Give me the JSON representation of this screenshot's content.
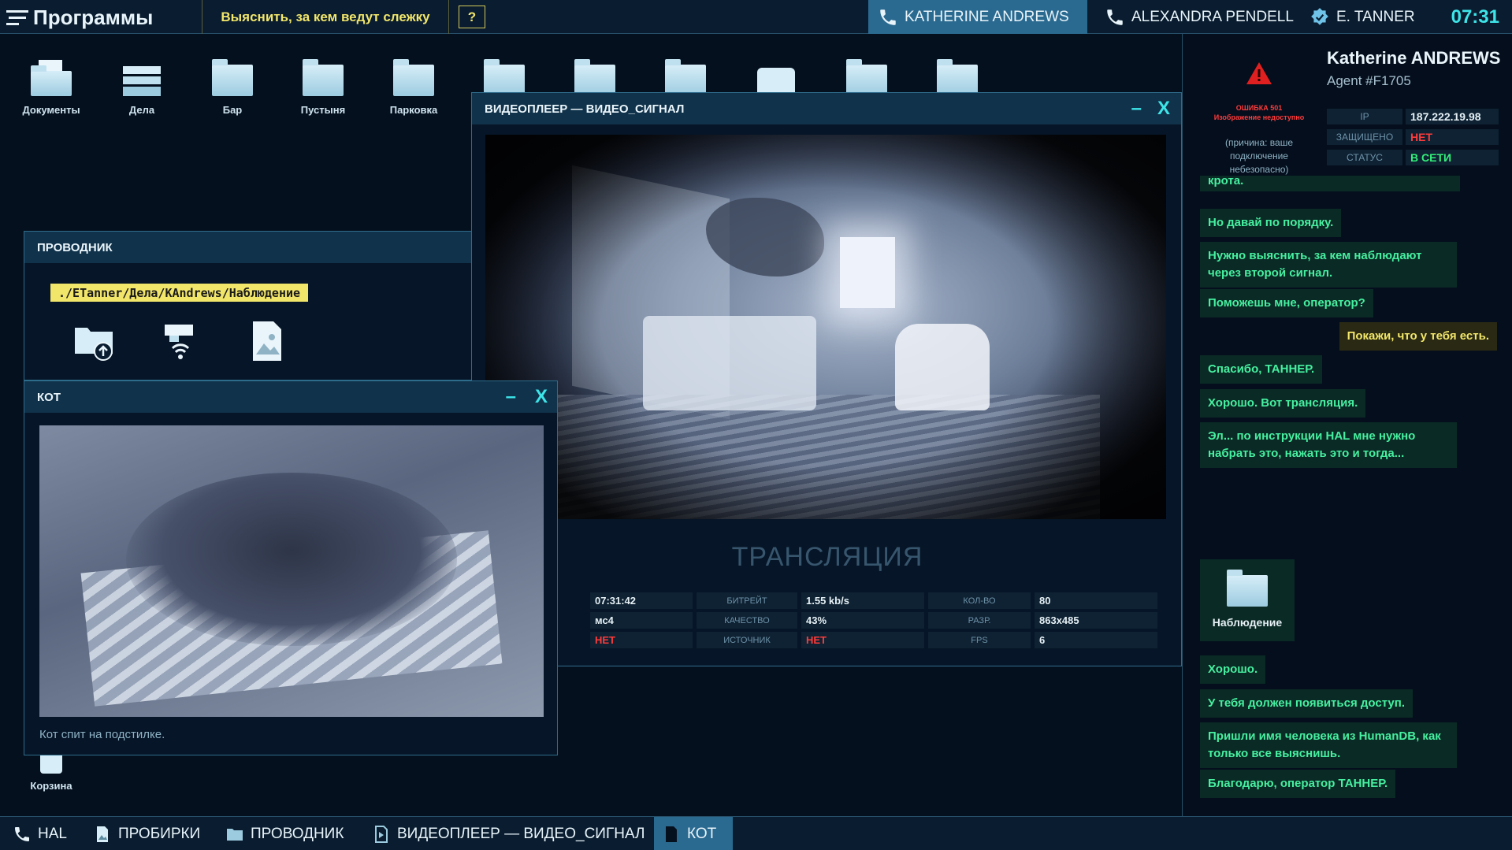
{
  "topbar": {
    "menu_label": "Программы",
    "objective": "Выяснить, за кем ведут слежку",
    "help_label": "?",
    "contacts": [
      {
        "name": "KATHERINE ANDREWS",
        "icon": "phone-icon"
      },
      {
        "name": "ALEXANDRA PENDELL",
        "icon": "phone-icon"
      },
      {
        "name": "E. TANNER",
        "icon": "badge-icon"
      }
    ],
    "clock": "07:31"
  },
  "desktop": {
    "icons": [
      {
        "label": "Документы",
        "icon": "documents-icon"
      },
      {
        "label": "Дела",
        "icon": "cases-icon"
      },
      {
        "label": "Бар",
        "icon": "folder-icon"
      },
      {
        "label": "Пустыня",
        "icon": "folder-icon"
      },
      {
        "label": "Парковка",
        "icon": "folder-icon"
      },
      {
        "label": "",
        "icon": "folder-icon"
      },
      {
        "label": "",
        "icon": "folder-icon"
      },
      {
        "label": "",
        "icon": "folder-icon"
      },
      {
        "label": "",
        "icon": "drive-icon"
      },
      {
        "label": "",
        "icon": "folder-icon"
      },
      {
        "label": "",
        "icon": "folder-icon"
      }
    ],
    "trash_label": "Корзина"
  },
  "explorer": {
    "title": "ПРОВОДНИК",
    "path": "./ETanner/Дела/KAndrews/Наблюдение"
  },
  "videoplayer": {
    "title": "ВИДЕОПЛЕЕР — ВИДЕО_СИГНАЛ",
    "stream_label": "ТРАНСЛЯЦИЯ",
    "stats": {
      "time": "07:31:42",
      "bitrate_label": "БИТРЕЙТ",
      "bitrate": "1.55 kb/s",
      "count_label": "КОЛ-ВО",
      "count": "80",
      "codec": "мс4",
      "quality_label": "КАЧЕСТВО",
      "quality": "43%",
      "res_label": "РАЗР.",
      "res": "863x485",
      "flag": "НЕТ",
      "source_label": "ИСТОЧНИК",
      "source": "НЕТ",
      "fps_label": "FPS",
      "fps": "6"
    }
  },
  "catwin": {
    "title": "КОТ",
    "caption": "Кот спит на подстилке."
  },
  "agent": {
    "name": "Katherine ANDREWS",
    "id": "Agent #F1705",
    "error_code": "ОШИБКА 501",
    "error_sub": "Изображение недоступно",
    "error_reason": "(причина: ваше подключение небезопасно)",
    "ip_label": "IP",
    "ip": "187.222.19.98",
    "secured_label": "ЗАЩИЩЕНО",
    "secured": "НЕТ",
    "status_label": "СТАТУС",
    "status": "В СЕТИ"
  },
  "chat": {
    "partial_top": "крота.",
    "messages": [
      {
        "from": "them",
        "text": "Но давай по порядку."
      },
      {
        "from": "them",
        "text": "Нужно выяснить, за кем наблюдают через второй сигнал."
      },
      {
        "from": "them",
        "text": "Поможешь мне, оператор?"
      },
      {
        "from": "me",
        "text": "Покажи, что у тебя есть."
      },
      {
        "from": "them",
        "text": "Спасибо, ТАННЕР."
      },
      {
        "from": "them",
        "text": "Хорошо. Вот трансляция."
      },
      {
        "from": "them",
        "text": "Эл... по инструкции HAL мне нужно набрать это, нажать это и тогда..."
      },
      {
        "from": "them",
        "text": "Хорошо."
      },
      {
        "from": "them",
        "text": "У тебя должен появиться доступ."
      },
      {
        "from": "them",
        "text": "Пришли имя человека из HumanDB, как только все выяснишь."
      },
      {
        "from": "them",
        "text": "Благодарю, оператор ТАННЕР."
      }
    ],
    "folder_label": "Наблюдение"
  },
  "taskbar": {
    "items": [
      {
        "label": "HAL",
        "icon": "phone-icon"
      },
      {
        "label": "ПРОБИРКИ",
        "icon": "image-icon"
      },
      {
        "label": "ПРОВОДНИК",
        "icon": "folder-icon"
      },
      {
        "label": "ВИДЕОПЛЕЕР — ВИДЕО_СИГНАЛ",
        "icon": "play-icon"
      },
      {
        "label": "КОТ",
        "icon": "document-icon"
      }
    ]
  },
  "colors": {
    "accent": "#3de4e8",
    "objective": "#f2e66a",
    "chat_them": "#46f0a0",
    "danger": "#ff3b3b",
    "ok": "#34f07a"
  }
}
